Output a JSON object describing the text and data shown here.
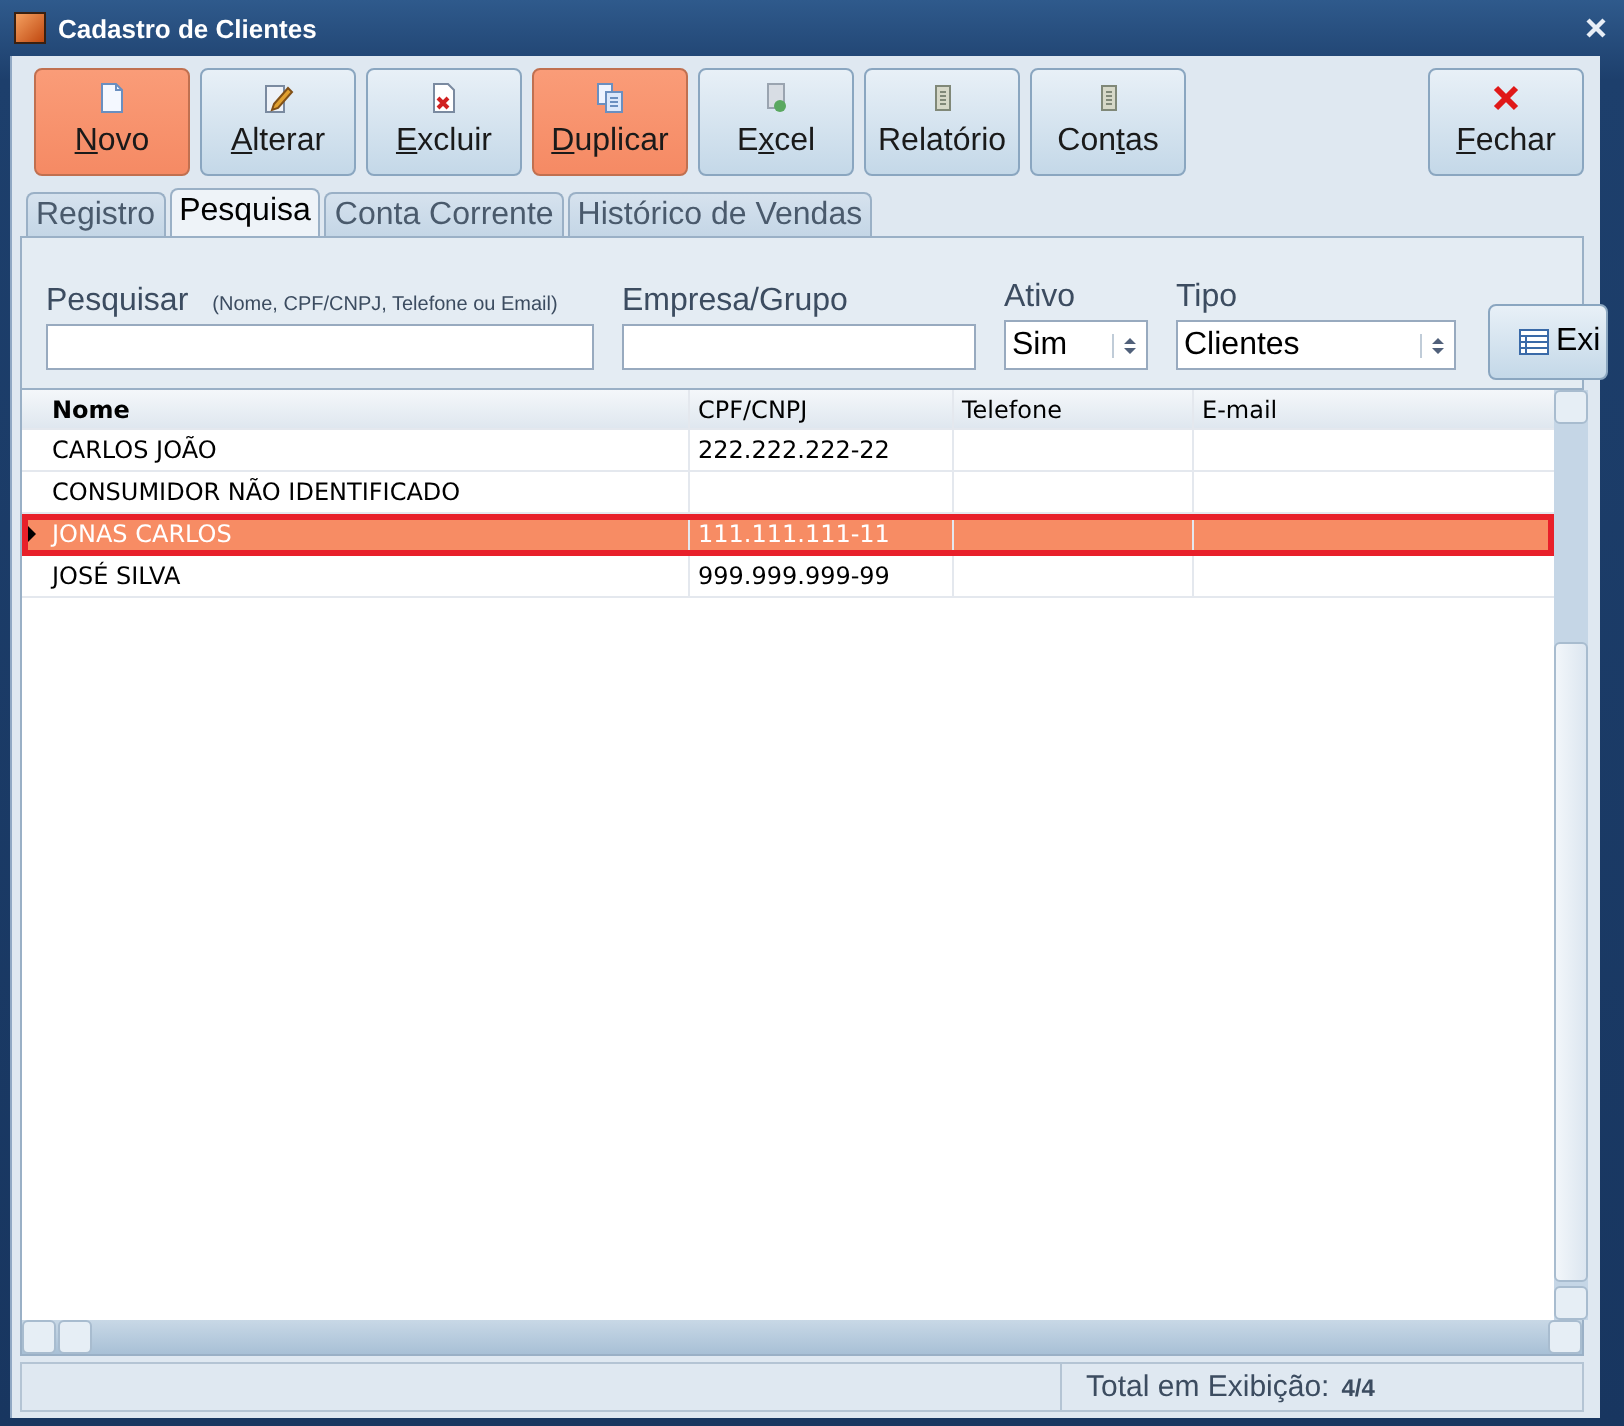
{
  "window": {
    "title": "Cadastro de Clientes"
  },
  "toolbar": [
    {
      "kind": "new",
      "key": "N",
      "rest": "ovo",
      "highlighted": true
    },
    {
      "kind": "edit",
      "key": "A",
      "rest": "lterar",
      "highlighted": false
    },
    {
      "kind": "delete",
      "key": "E",
      "rest": "xcluir",
      "highlighted": false
    },
    {
      "kind": "copy",
      "key": "D",
      "rest": "uplicar",
      "highlighted": true
    },
    {
      "kind": "excel",
      "before": "E",
      "key": "x",
      "rest": "cel",
      "highlighted": false
    },
    {
      "kind": "report",
      "rest": "Relatório",
      "highlighted": false
    },
    {
      "kind": "report",
      "before": "Con",
      "key": "t",
      "rest": "as",
      "highlighted": false
    }
  ],
  "close_button": {
    "kind": "close",
    "key": "F",
    "rest": "echar"
  },
  "tabs": [
    {
      "label": "Registro",
      "selected": false
    },
    {
      "label": "Pesquisa",
      "selected": true
    },
    {
      "label": "Conta Corrente",
      "selected": false
    },
    {
      "label": "Histórico de Vendas",
      "selected": false
    }
  ],
  "filters": {
    "search_label": "Pesquisar",
    "search_hint": "(Nome, CPF/CNPJ, Telefone ou Email)",
    "company_label": "Empresa/Grupo",
    "active_label": "Ativo",
    "active_value": "Sim",
    "type_label": "Tipo",
    "type_value": "Clientes",
    "show_button": "Exi"
  },
  "table": {
    "columns": [
      "Nome",
      "CPF/CNPJ",
      "Telefone",
      "E-mail"
    ],
    "rows": [
      {
        "cells": [
          "CARLOS JOÃO",
          "222.222.222-22",
          "",
          ""
        ],
        "selected": false
      },
      {
        "cells": [
          "CONSUMIDOR NÃO IDENTIFICADO",
          "",
          "",
          ""
        ],
        "selected": false
      },
      {
        "cells": [
          "JONAS CARLOS",
          "111.111.111-11",
          "",
          ""
        ],
        "selected": true
      },
      {
        "cells": [
          "JOSÉ SILVA",
          "999.999.999-99",
          "",
          ""
        ],
        "selected": false
      }
    ]
  },
  "status_bar": {
    "label": "Total em Exibição:",
    "value": "4/4"
  }
}
